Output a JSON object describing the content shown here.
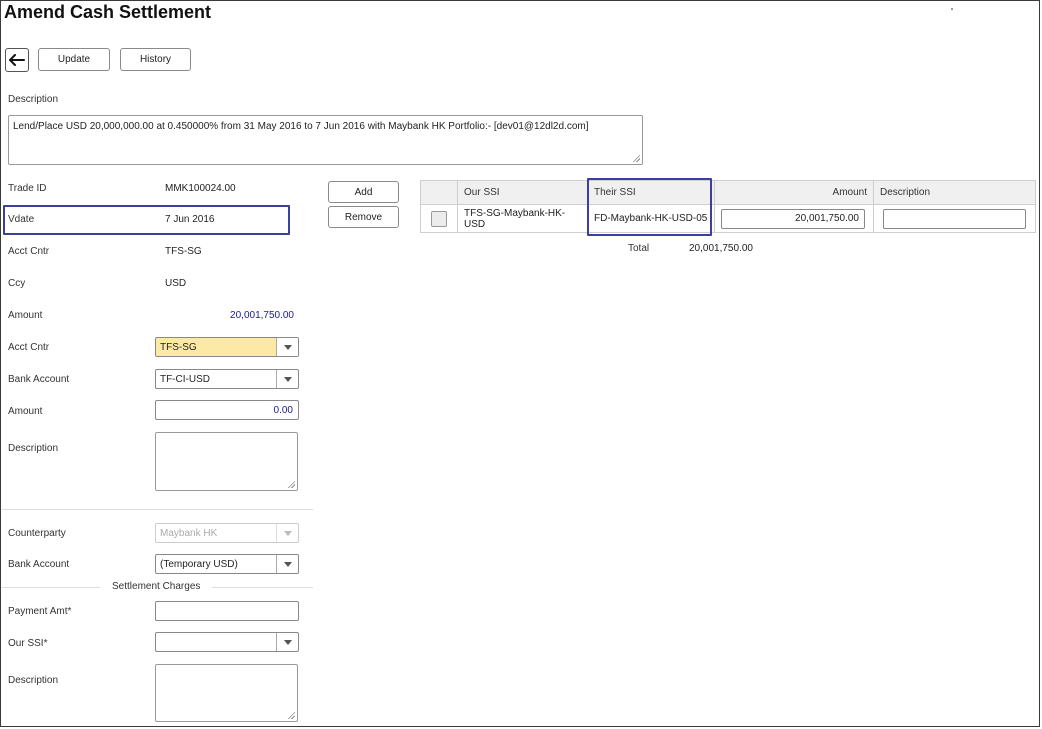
{
  "page": {
    "title": "Amend Cash Settlement"
  },
  "toolbar": {
    "update_label": "Update",
    "history_label": "History"
  },
  "description": {
    "label": "Description",
    "value": "Lend/Place USD 20,000,000.00 at 0.450000% from 31 May 2016 to 7 Jun 2016 with Maybank HK  Portfolio:- [dev01@12dl2d.com]"
  },
  "trade": {
    "trade_id_label": "Trade ID",
    "trade_id": "MMK100024.00",
    "vdate_label": "Vdate",
    "vdate": "7 Jun 2016",
    "acct_cntr_label": "Acct Cntr",
    "acct_cntr": "TFS-SG",
    "ccy_label": "Ccy",
    "ccy": "USD",
    "amount_label": "Amount",
    "amount": "20,001,750.00"
  },
  "our_side": {
    "acct_cntr_label": "Acct Cntr",
    "acct_cntr": "TFS-SG",
    "bank_account_label": "Bank Account",
    "bank_account": "TF-CI-USD",
    "amount_label": "Amount",
    "amount": "0.00",
    "description_label": "Description"
  },
  "counterparty": {
    "counterparty_label": "Counterparty",
    "counterparty": "Maybank HK",
    "bank_account_label": "Bank Account",
    "bank_account": "(Temporary USD)"
  },
  "settlement_charges": {
    "heading": "Settlement Charges",
    "payment_amt_label": "Payment Amt*",
    "our_ssi_label": "Our SSI*",
    "description_label": "Description"
  },
  "ssi_actions": {
    "add_label": "Add",
    "remove_label": "Remove"
  },
  "ssi_table": {
    "headers": {
      "our_ssi": "Our SSI",
      "their_ssi": "Their SSI",
      "amount": "Amount",
      "description": "Description"
    },
    "rows": [
      {
        "our_ssi": "TFS-SG-Maybank-HK-USD",
        "their_ssi": "FD-Maybank-HK-USD-05",
        "amount": "20,001,750.00",
        "description": ""
      }
    ],
    "total_label": "Total",
    "total_value": "20,001,750.00"
  },
  "colors": {
    "highlight": "#3b3f9e",
    "accent_amount": "#1a1a8c",
    "selected_field": "#fde9a6"
  },
  "icons": {
    "back": "arrow-left-icon",
    "dropdown": "chevron-down-icon"
  }
}
